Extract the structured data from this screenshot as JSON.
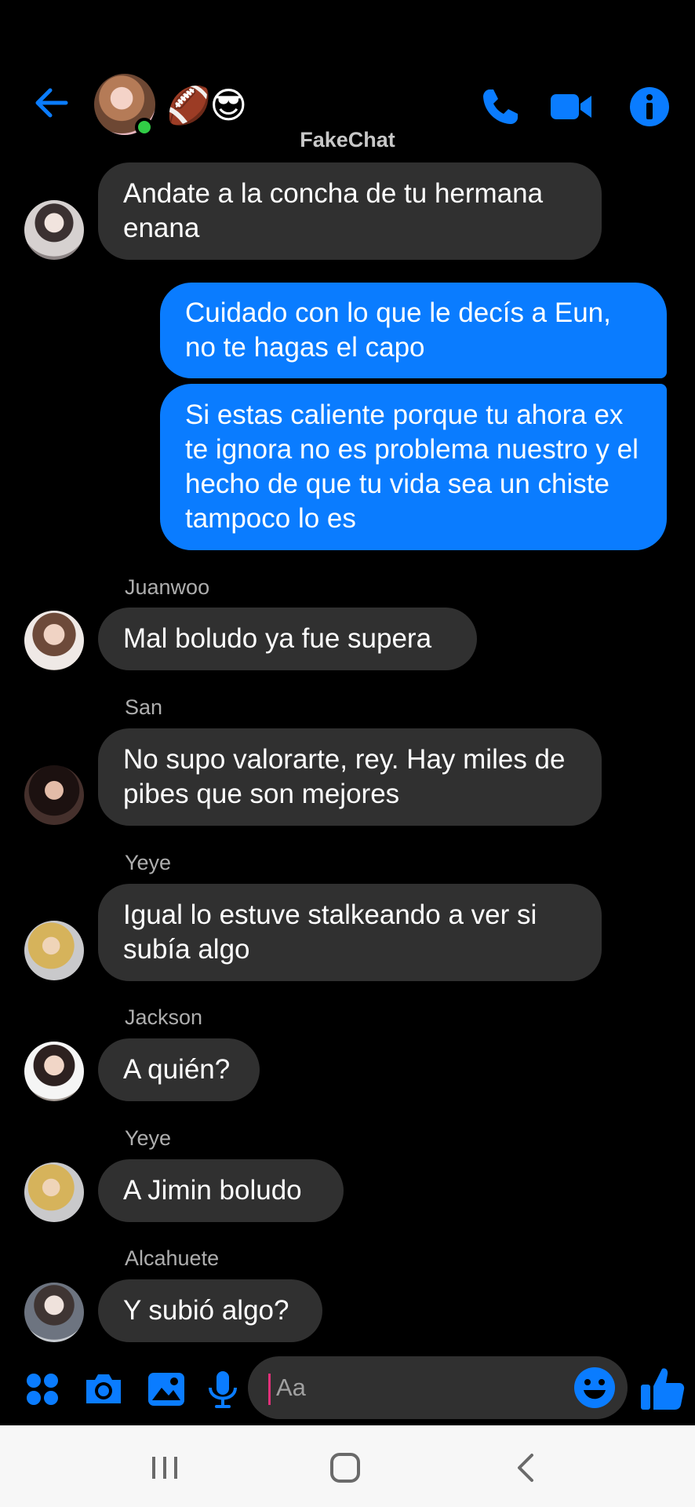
{
  "header": {
    "title": "FakeChat",
    "emojis": "🏈😎",
    "icons": [
      "back-arrow-icon",
      "phone-icon",
      "video-camera-icon",
      "info-icon"
    ],
    "accent_color": "#0a7cff",
    "online_color": "#31cc46"
  },
  "messages": [
    {
      "direction": "in",
      "text": "Andate a la concha de tu hermana enana"
    },
    {
      "direction": "out",
      "text": "Cuidado con lo que le decís a Eun, no te hagas el capo"
    },
    {
      "direction": "out",
      "text": "Si estas caliente porque tu ahora ex te ignora no es problema nuestro y el hecho de que tu vida sea un chiste tampoco lo es"
    },
    {
      "direction": "in",
      "sender": "Juanwoo",
      "text": "Mal boludo ya fue supera"
    },
    {
      "direction": "in",
      "sender": "San",
      "text": "No supo valorarte, rey. Hay miles de pibes que son mejores"
    },
    {
      "direction": "in",
      "sender": "Yeye",
      "text": "Igual lo estuve stalkeando a ver si subía algo"
    },
    {
      "direction": "in",
      "sender": "Jackson",
      "text": "A quién?"
    },
    {
      "direction": "in",
      "sender": "Yeye",
      "text": "A Jimin boludo"
    },
    {
      "direction": "in",
      "sender": "Alcahuete",
      "text": "Y subió algo?"
    }
  ],
  "composer": {
    "placeholder": "Aa",
    "icons": [
      "apps-grid-icon",
      "camera-icon",
      "gallery-icon",
      "microphone-icon",
      "emoji-icon",
      "thumbs-up-icon"
    ]
  },
  "navbar": {
    "icons": [
      "recent-apps-icon",
      "home-icon",
      "back-icon"
    ]
  }
}
